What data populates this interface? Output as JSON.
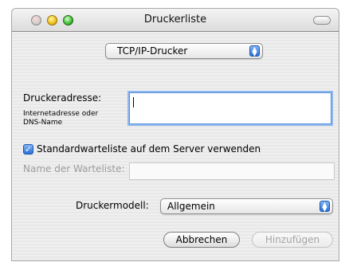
{
  "window": {
    "title": "Druckerliste"
  },
  "connection_popup": {
    "value": "TCP/IP-Drucker"
  },
  "address": {
    "label": "Druckeradresse:",
    "hint_line1": "Internetadresse oder",
    "hint_line2": "DNS-Name",
    "value": ""
  },
  "queue": {
    "checkbox_label": "Standardwarteliste auf dem Server verwenden",
    "checked": true,
    "name_label": "Name der Warteliste:",
    "name_value": ""
  },
  "model": {
    "label": "Druckermodell:",
    "value": "Allgemein"
  },
  "buttons": {
    "cancel": "Abbrechen",
    "add": "Hinzufügen"
  },
  "colors": {
    "accent": "#2a6fd8",
    "window_bg": "#ececec"
  }
}
